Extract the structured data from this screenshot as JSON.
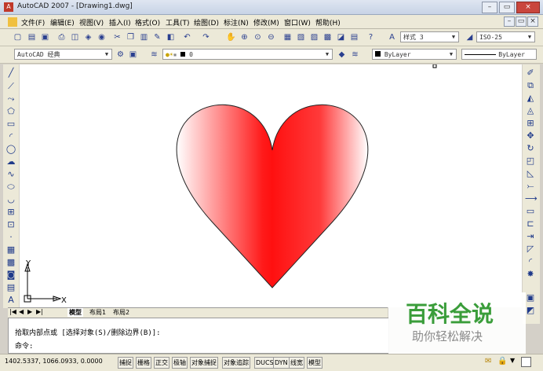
{
  "titlebar": {
    "title": "AutoCAD 2007 - [Drawing1.dwg]",
    "min": "–",
    "max": "▭",
    "close": "×"
  },
  "menu": [
    "文件(F)",
    "编辑(E)",
    "视图(V)",
    "插入(I)",
    "格式(O)",
    "工具(T)",
    "绘图(D)",
    "标注(N)",
    "修改(M)",
    "窗口(W)",
    "帮助(H)"
  ],
  "toolbar1": {
    "textstyle": "样式 3",
    "dimstyle": "ISO-25"
  },
  "toolbar2": {
    "workspace": "AutoCAD 经典",
    "layer": "0",
    "color": "ByLayer",
    "linetype": "ByLayer"
  },
  "canvas": {
    "heart_fill": "#ff2020",
    "ucs_x": "X",
    "ucs_y": "Y"
  },
  "tabs": [
    "模型",
    "布局1",
    "布局2"
  ],
  "command": {
    "line1": "拾取内部点或 [选择对象(S)/删除边界(B)]:",
    "line2": "命令:"
  },
  "status": {
    "coords": "1402.5337, 1066.0933, 0.0000",
    "buttons": [
      "捕捉",
      "栅格",
      "正交",
      "极轴",
      "对象捕捉",
      "对象追踪",
      "DUCS",
      "DYN",
      "线宽",
      "模型"
    ]
  },
  "watermark": {
    "title": "百科全说",
    "subtitle": "助你轻松解决",
    "color": "#3a9d3a"
  }
}
